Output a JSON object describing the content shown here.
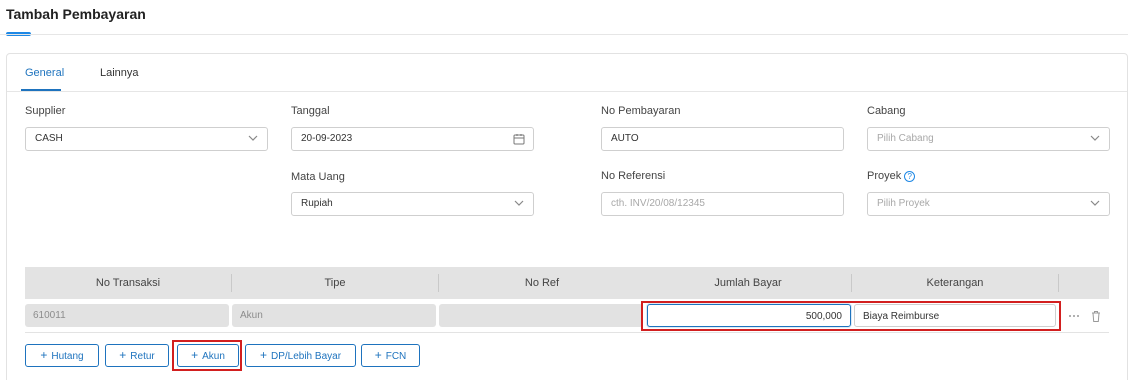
{
  "page": {
    "title": "Tambah Pembayaran"
  },
  "tabs": [
    {
      "label": "General",
      "active": true
    },
    {
      "label": "Lainnya",
      "active": false
    }
  ],
  "form": {
    "supplier": {
      "label": "Supplier",
      "value": "CASH"
    },
    "tanggal": {
      "label": "Tanggal",
      "value": "20-09-2023"
    },
    "no_pembayaran": {
      "label": "No Pembayaran",
      "value": "AUTO"
    },
    "cabang": {
      "label": "Cabang",
      "placeholder": "Pilih Cabang"
    },
    "mata_uang": {
      "label": "Mata Uang",
      "value": "Rupiah"
    },
    "no_referensi": {
      "label": "No Referensi",
      "placeholder": "cth. INV/20/08/12345"
    },
    "proyek": {
      "label": "Proyek",
      "placeholder": "Pilih Proyek",
      "help_icon": "question-circle-icon"
    }
  },
  "table": {
    "headers": [
      "No Transaksi",
      "Tipe",
      "No Ref",
      "Jumlah Bayar",
      "Keterangan"
    ],
    "rows": [
      {
        "no_transaksi": "610011",
        "tipe": "Akun",
        "no_ref": "",
        "jumlah_bayar": "500,000",
        "keterangan": "Biaya Reimburse"
      }
    ]
  },
  "buttons": {
    "hutang": "Hutang",
    "retur": "Retur",
    "akun": "Akun",
    "dp": "DP/Lebih Bayar",
    "fcn": "FCN"
  },
  "colors": {
    "accent": "#1e73be",
    "highlight": "#d21f1f",
    "header_bg": "#e3e3e3"
  }
}
